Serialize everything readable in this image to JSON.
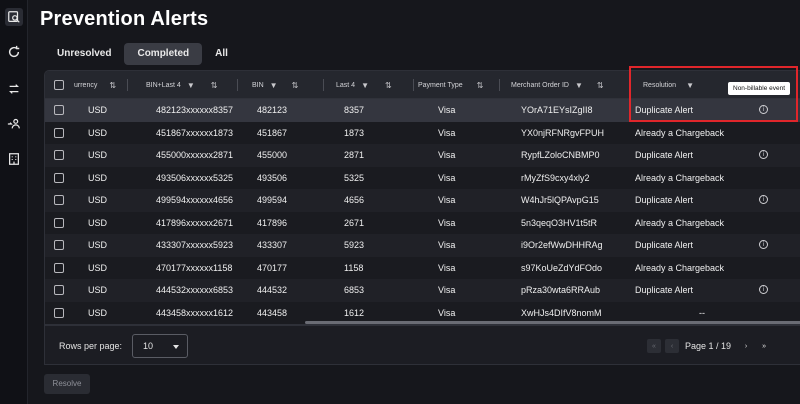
{
  "page": {
    "title": "Prevention Alerts"
  },
  "sidebar": {
    "items": [
      {
        "name": "alerts-search-icon",
        "active": true
      },
      {
        "name": "refresh-icon",
        "active": false
      },
      {
        "name": "transfer-icon",
        "active": false
      },
      {
        "name": "user-flow-icon",
        "active": false
      },
      {
        "name": "building-icon",
        "active": false
      }
    ]
  },
  "tabs": [
    {
      "label": "Unresolved",
      "active": false
    },
    {
      "label": "Completed",
      "active": true
    },
    {
      "label": "All",
      "active": false
    }
  ],
  "table": {
    "columns": [
      {
        "label": "urrency",
        "icon": "sort-icon",
        "icon_glyph": "⇅"
      },
      {
        "label": "BIN+Last 4",
        "icon": "filter-icon",
        "icon_glyph": "▼",
        "icon2": "sort-icon",
        "icon2_glyph": "⇅"
      },
      {
        "label": "BIN",
        "icon": "filter-icon",
        "icon_glyph": "▼",
        "icon2": "sort-icon",
        "icon2_glyph": "⇅"
      },
      {
        "label": "Last 4",
        "icon": "filter-icon",
        "icon_glyph": "▼",
        "icon2": "sort-icon",
        "icon2_glyph": "⇅"
      },
      {
        "label": "Payment Type",
        "icon": "sort-icon",
        "icon_glyph": "⇅"
      },
      {
        "label": "Merchant Order ID",
        "icon": "filter-icon",
        "icon_glyph": "▼",
        "icon2": "sort-icon",
        "icon2_glyph": "⇅"
      },
      {
        "label": "Resolution",
        "icon": "filter-icon",
        "icon_glyph": "▼"
      }
    ],
    "rows": [
      {
        "currency": "USD",
        "bin_last4": "482123xxxxxx8357",
        "bin": "482123",
        "last4": "8357",
        "payment_type": "Visa",
        "order_id": "YOrA71EYsIZgII8",
        "resolution": "Duplicate Alert",
        "info": true,
        "selected": true
      },
      {
        "currency": "USD",
        "bin_last4": "451867xxxxxx1873",
        "bin": "451867",
        "last4": "1873",
        "payment_type": "Visa",
        "order_id": "YX0njRFNRgvFPUH",
        "resolution": "Already a Chargeback",
        "info": false
      },
      {
        "currency": "USD",
        "bin_last4": "455000xxxxxx2871",
        "bin": "455000",
        "last4": "2871",
        "payment_type": "Visa",
        "order_id": "RypfLZoloCNBMP0",
        "resolution": "Duplicate Alert",
        "info": true
      },
      {
        "currency": "USD",
        "bin_last4": "493506xxxxxx5325",
        "bin": "493506",
        "last4": "5325",
        "payment_type": "Visa",
        "order_id": "rMyZfS9cxy4xly2",
        "resolution": "Already a Chargeback",
        "info": false
      },
      {
        "currency": "USD",
        "bin_last4": "499594xxxxxx4656",
        "bin": "499594",
        "last4": "4656",
        "payment_type": "Visa",
        "order_id": "W4hJr5lQPAvpG15",
        "resolution": "Duplicate Alert",
        "info": true
      },
      {
        "currency": "USD",
        "bin_last4": "417896xxxxxx2671",
        "bin": "417896",
        "last4": "2671",
        "payment_type": "Visa",
        "order_id": "5n3qeqO3HV1t5tR",
        "resolution": "Already a Chargeback",
        "info": false
      },
      {
        "currency": "USD",
        "bin_last4": "433307xxxxxx5923",
        "bin": "433307",
        "last4": "5923",
        "payment_type": "Visa",
        "order_id": "i9Or2efWwDHHRAg",
        "resolution": "Duplicate Alert",
        "info": true
      },
      {
        "currency": "USD",
        "bin_last4": "470177xxxxxx1158",
        "bin": "470177",
        "last4": "1158",
        "payment_type": "Visa",
        "order_id": "s97KoUeZdYdFOdo",
        "resolution": "Already a Chargeback",
        "info": false
      },
      {
        "currency": "USD",
        "bin_last4": "444532xxxxxx6853",
        "bin": "444532",
        "last4": "6853",
        "payment_type": "Visa",
        "order_id": "pRza30wta6RRAub",
        "resolution": "Duplicate Alert",
        "info": true
      },
      {
        "currency": "USD",
        "bin_last4": "443458xxxxxx1612",
        "bin": "443458",
        "last4": "1612",
        "payment_type": "Visa",
        "order_id": "XwHJs4DIfV8nomM",
        "resolution": "--",
        "info": false
      }
    ]
  },
  "tooltip": {
    "text": "Non-billable event"
  },
  "pagination": {
    "rows_per_page_label": "Rows per page:",
    "rows_per_page_value": "10",
    "page_info": "Page 1 / 19",
    "first_icon": "«",
    "prev_icon": "‹",
    "next_icon": "›",
    "last_icon": "»"
  },
  "actions": {
    "resolve_label": "Resolve"
  },
  "colors": {
    "background": "#16171c",
    "highlight": "#e0262b",
    "selected_row": "#34363f"
  }
}
